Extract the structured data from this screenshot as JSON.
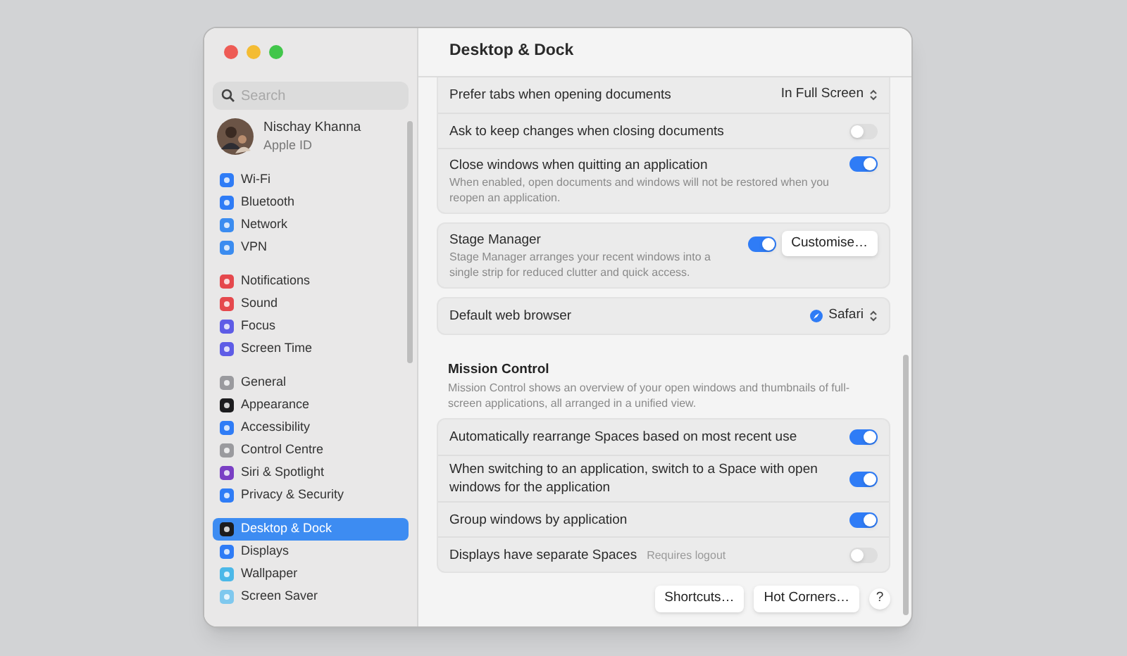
{
  "sidebar": {
    "search": {
      "placeholder": "Search"
    },
    "account": {
      "name": "Nischay Khanna",
      "subtitle": "Apple ID"
    },
    "groups": [
      [
        {
          "label": "Wi-Fi",
          "color": "#2f7cf6",
          "selected": false
        },
        {
          "label": "Bluetooth",
          "color": "#2f7cf6",
          "selected": false
        },
        {
          "label": "Network",
          "color": "#3b8cf0",
          "selected": false
        },
        {
          "label": "VPN",
          "color": "#3b8cf0",
          "selected": false
        }
      ],
      [
        {
          "label": "Notifications",
          "color": "#e5484d",
          "selected": false
        },
        {
          "label": "Sound",
          "color": "#e5484d",
          "selected": false
        },
        {
          "label": "Focus",
          "color": "#5e5ce6",
          "selected": false
        },
        {
          "label": "Screen Time",
          "color": "#5e5ce6",
          "selected": false
        }
      ],
      [
        {
          "label": "General",
          "color": "#9a9a9e",
          "selected": false
        },
        {
          "label": "Appearance",
          "color": "#1c1c1e",
          "selected": false
        },
        {
          "label": "Accessibility",
          "color": "#2f7cf6",
          "selected": false
        },
        {
          "label": "Control Centre",
          "color": "#9a9a9e",
          "selected": false
        },
        {
          "label": "Siri & Spotlight",
          "color": "#7a3fc4",
          "selected": false
        },
        {
          "label": "Privacy & Security",
          "color": "#2f7cf6",
          "selected": false
        }
      ],
      [
        {
          "label": "Desktop & Dock",
          "color": "#1c1c1e",
          "selected": true
        },
        {
          "label": "Displays",
          "color": "#2f7cf6",
          "selected": false
        },
        {
          "label": "Wallpaper",
          "color": "#4bb8e8",
          "selected": false
        },
        {
          "label": "Screen Saver",
          "color": "#7fc8ee",
          "selected": false
        }
      ]
    ]
  },
  "main": {
    "title": "Desktop & Dock",
    "cards": [
      {
        "rows": [
          {
            "kind": "popup",
            "label": "Prefer tabs when opening documents",
            "value": "In Full Screen"
          },
          {
            "kind": "toggle",
            "label": "Ask to keep changes when closing documents",
            "on": false
          },
          {
            "kind": "toggle",
            "label": "Close windows when quitting an application",
            "description": "When enabled, open documents and windows will not be restored when you reopen an application.",
            "on": true
          }
        ]
      },
      {
        "rows": [
          {
            "kind": "toggle",
            "label": "Stage Manager",
            "description": "Stage Manager arranges your recent windows into a single strip for reduced clutter and quick access.",
            "on": true,
            "button": "Customise…"
          }
        ]
      },
      {
        "rows": [
          {
            "kind": "popup",
            "label": "Default web browser",
            "value": "Safari",
            "app_icon": true
          }
        ]
      },
      {
        "heading": "Mission Control",
        "description": "Mission Control shows an overview of your open windows and thumbnails of full-screen applications, all arranged in a unified view.",
        "rows": [
          {
            "kind": "toggle",
            "label": "Automatically rearrange Spaces based on most recent use",
            "on": true
          },
          {
            "kind": "toggle",
            "label": "When switching to an application, switch to a Space with open windows for the application",
            "on": true
          },
          {
            "kind": "toggle",
            "label": "Group windows by application",
            "on": true
          },
          {
            "kind": "toggle",
            "label": "Displays have separate Spaces",
            "note": "Requires logout",
            "on": false
          }
        ]
      }
    ],
    "footer_buttons": [
      "Shortcuts…",
      "Hot Corners…"
    ],
    "help": "?"
  }
}
